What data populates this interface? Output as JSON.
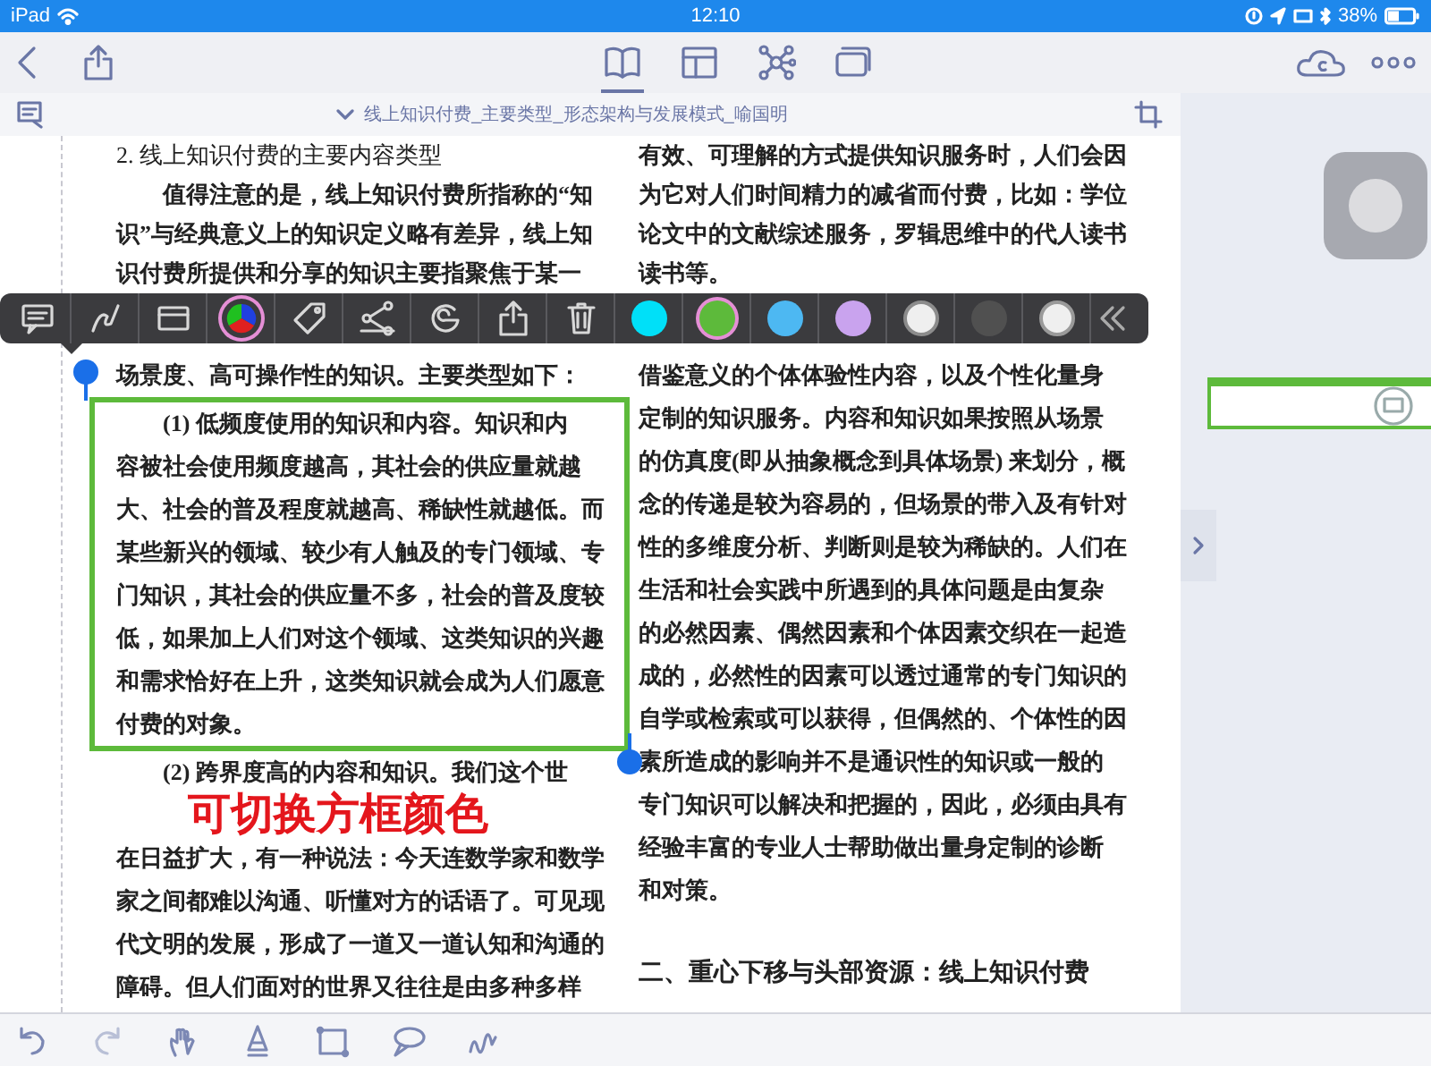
{
  "status_bar": {
    "device": "iPad",
    "time": "12:10",
    "battery": "38%"
  },
  "nav_bar": {
    "view_tabs": [
      {
        "kind": "book",
        "selected": true
      },
      {
        "kind": "layout",
        "selected": false
      },
      {
        "kind": "mindmap",
        "selected": false
      },
      {
        "kind": "cards",
        "selected": false
      }
    ]
  },
  "document": {
    "title": "线上知识付费_主要类型_形态架构与发展模式_喻国明",
    "above_toolbar": {
      "left_column": [
        {
          "kind": "subheading",
          "text": "2. 线上知识付费的主要内容类型"
        },
        {
          "kind": "text",
          "lines": [
            {
              "text": "值得注意的是，线上知识付费所指称的“知",
              "indent": true
            },
            {
              "text": "识”与经典意义上的知识定义略有差异，线上知",
              "indent": false
            },
            {
              "text": "识付费所提供和分享的知识主要指聚焦于某一",
              "indent": false
            }
          ]
        }
      ],
      "right_column": [
        {
          "kind": "text",
          "lines": [
            {
              "text": "有效、可理解的方式提供知识服务时，人们会因",
              "indent": false
            },
            {
              "text": "为它对人们时间精力的减省而付费，比如：学位",
              "indent": false
            },
            {
              "text": "论文中的文献综述服务，罗辑思维中的代人读书",
              "indent": false
            },
            {
              "text": "读书等。",
              "indent": false
            }
          ]
        }
      ]
    },
    "below_toolbar": {
      "left_column": [
        {
          "kind": "text",
          "lines": [
            {
              "text": "场景度、高可操作性的知识。主要类型如下：",
              "indent": false
            }
          ]
        },
        {
          "kind": "box",
          "lines": [
            {
              "text": "(1) 低频度使用的知识和内容。知识和内",
              "indent": true
            },
            {
              "text": "容被社会使用频度越高，其社会的供应量就越",
              "indent": false
            },
            {
              "text": "大、社会的普及程度就越高、稀缺性就越低。而",
              "indent": false
            },
            {
              "text": "某些新兴的领域、较少有人触及的专门领域、专",
              "indent": false
            },
            {
              "text": "门知识，其社会的供应量不多，社会的普及度较",
              "indent": false
            },
            {
              "text": "低，如果加上人们对这个领域、这类知识的兴趣",
              "indent": false
            },
            {
              "text": "和需求恰好在上升，这类知识就会成为人们愿意",
              "indent": false
            },
            {
              "text": "付费的对象。",
              "indent": false
            }
          ]
        },
        {
          "kind": "text",
          "lines": [
            {
              "text": "(2) 跨界度高的内容和知识。我们这个世",
              "indent": true
            }
          ]
        },
        {
          "kind": "caption",
          "text": "可切换方框颜色"
        },
        {
          "kind": "text",
          "lines": [
            {
              "text": "在日益扩大，有一种说法：今天连数学家和数学",
              "indent": false
            },
            {
              "text": "家之间都难以沟通、听懂对方的话语了。可见现",
              "indent": false
            },
            {
              "text": "代文明的发展，形成了一道又一道认知和沟通的",
              "indent": false
            },
            {
              "text": "障碍。但人们面对的世界又往往是由多种多样",
              "indent": false
            }
          ]
        }
      ],
      "right_column": [
        {
          "kind": "text",
          "lines": [
            {
              "text": "借鉴意义的个体体验性内容，以及个性化量身",
              "indent": false
            },
            {
              "text": "定制的知识服务。内容和知识如果按照从场景",
              "indent": false
            },
            {
              "text": "的仿真度(即从抽象概念到具体场景) 来划分，概",
              "indent": false
            },
            {
              "text": "念的传递是较为容易的，但场景的带入及有针对",
              "indent": false
            },
            {
              "text": "性的多维度分析、判断则是较为稀缺的。人们在",
              "indent": false
            },
            {
              "text": "生活和社会实践中所遇到的具体问题是由复杂",
              "indent": false
            },
            {
              "text": "的必然因素、偶然因素和个体因素交织在一起造",
              "indent": false
            },
            {
              "text": "成的，必然性的因素可以透过通常的专门知识的",
              "indent": false
            },
            {
              "text": "自学或检索或可以获得，但偶然的、个体性的因",
              "indent": false
            },
            {
              "text": "素所造成的影响并不是通识性的知识或一般的",
              "indent": false
            },
            {
              "text": "专门知识可以解决和把握的，因此，必须由具有",
              "indent": false
            },
            {
              "text": "经验丰富的专业人士帮助做出量身定制的诊断",
              "indent": false
            },
            {
              "text": "和对策。",
              "indent": false
            }
          ]
        },
        {
          "kind": "section_heading",
          "text": "二、重心下移与头部资源：线上知识付费"
        }
      ]
    }
  },
  "annotation_toolbar": {
    "tools": [
      {
        "kind": "comment",
        "selected": false
      },
      {
        "kind": "pen",
        "selected": false
      },
      {
        "kind": "window",
        "selected": false
      },
      {
        "kind": "color_wheel",
        "selected": true
      },
      {
        "kind": "tag",
        "selected": false
      },
      {
        "kind": "nodes",
        "selected": false
      },
      {
        "kind": "spiral",
        "selected": false
      },
      {
        "kind": "export",
        "selected": false
      },
      {
        "kind": "trash",
        "selected": false
      }
    ],
    "swatches": [
      {
        "kind": "fill",
        "color": "#00e0f8",
        "selected": false
      },
      {
        "kind": "fill",
        "color": "#5dba3b",
        "selected": true
      },
      {
        "kind": "fill",
        "color": "#4db8f2",
        "selected": false
      },
      {
        "kind": "fill",
        "color": "#c9a3ee",
        "selected": false
      },
      {
        "kind": "ring",
        "color": "#8c8c8c",
        "selected": false
      },
      {
        "kind": "fill",
        "color": "#505050",
        "selected": false
      },
      {
        "kind": "ring",
        "color": "#9a9a9a",
        "selected": false
      }
    ]
  },
  "bottom_toolbar": {
    "tools": [
      {
        "kind": "undo"
      },
      {
        "kind": "redo"
      },
      {
        "kind": "hand"
      },
      {
        "kind": "pen"
      },
      {
        "kind": "rectangle"
      },
      {
        "kind": "bubble"
      },
      {
        "kind": "squiggle"
      }
    ]
  }
}
